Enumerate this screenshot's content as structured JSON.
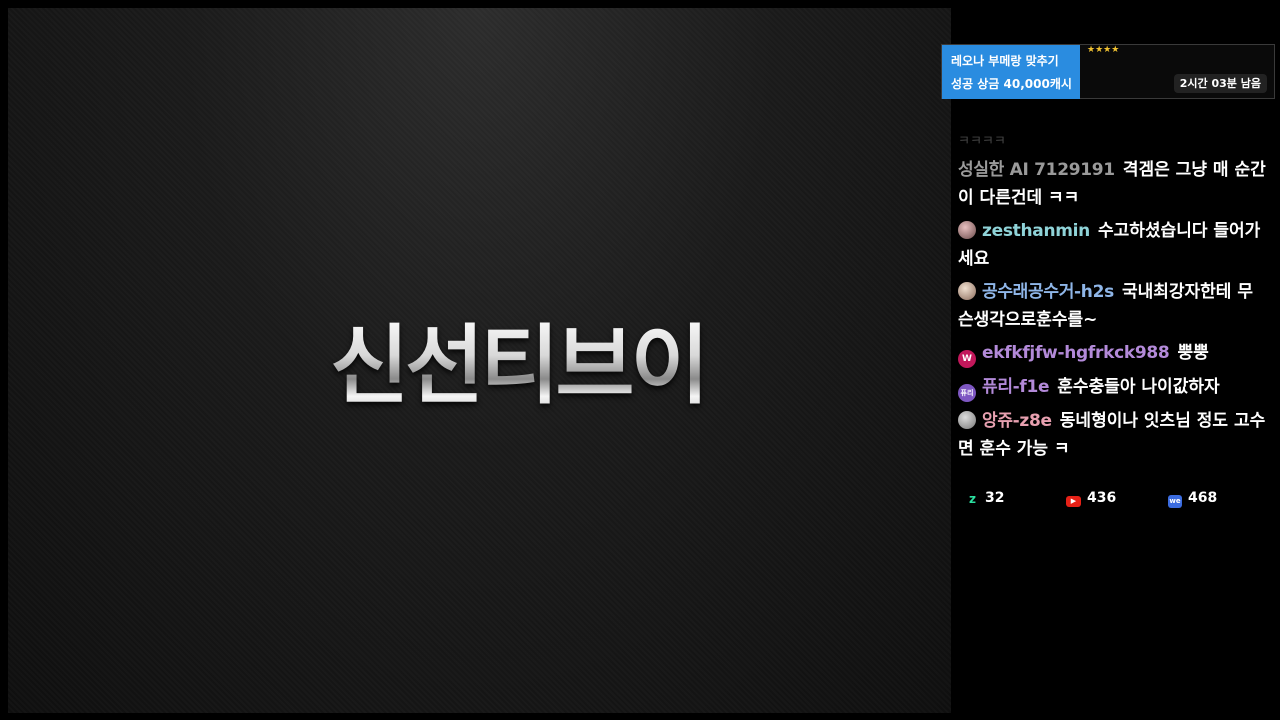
{
  "stream": {
    "logo_text": "신선티브이"
  },
  "mission": {
    "line1": "레오나 부메랑 맞추기",
    "line2": "성공 상금 40,000캐시",
    "stars": "★★★★",
    "time_left": "2시간 03분 남음"
  },
  "chat": {
    "faded_line": "ㅋㅋㅋㅋ",
    "messages": [
      {
        "nick": "성실한 AI 7129191",
        "text": "격겜은 그냥 매 순간이 다른건데 ㅋㅋ",
        "nick_color": "#9a9a9a",
        "badge": ""
      },
      {
        "nick": "zesthanmin",
        "text": "수고하셨습니다 들어가세요",
        "nick_color": "#8fd3d8",
        "badge": "avatar"
      },
      {
        "nick": "공수래공수거-h2s",
        "text": "국내최강자한테 무슨생각으로훈수를~",
        "nick_color": "#8fb6e8",
        "badge": "avatar"
      },
      {
        "nick": "ekfkfjfw-hgfrkck988",
        "text": "뿡뿡",
        "nick_color": "#b38ad9",
        "badge": "W"
      },
      {
        "nick": "퓨리-f1e",
        "text": "훈수충들아 나이값하자",
        "nick_color": "#b38ad9",
        "badge": "퓨리"
      },
      {
        "nick": "앙쥬-z8e",
        "text": "동네형이나 잇츠님 정도 고수면 훈수 가능 ㅋ",
        "nick_color": "#e7a0b0",
        "badge": "avatar"
      }
    ]
  },
  "stats": {
    "twitch_icon": "z",
    "twitch_count": "32",
    "youtube_icon": "▶",
    "youtube_count": "436",
    "afreeca_icon": "we",
    "afreeca_count": "468"
  },
  "colors": {
    "mission_bg": "#2a8ce0",
    "youtube_red": "#e62117",
    "twitch_green": "#2be0a0",
    "afreeca_blue": "#3b6ce0"
  }
}
